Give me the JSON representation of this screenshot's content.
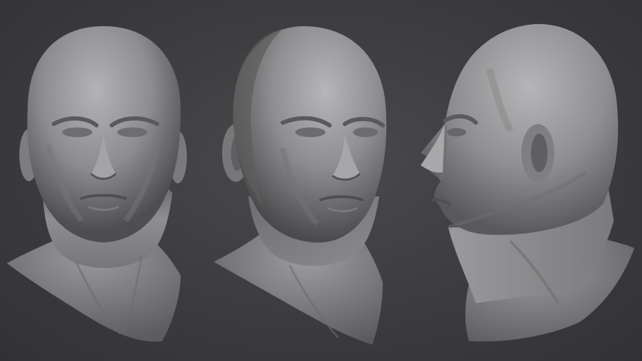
{
  "scene": {
    "background_color": "#3d3d3f",
    "material_color": "#9a9a9c",
    "views": [
      {
        "id": "front",
        "description_icon": "head-front-render"
      },
      {
        "id": "three-quarter",
        "description_icon": "head-three-quarter-render"
      },
      {
        "id": "profile",
        "description_icon": "head-profile-render"
      }
    ]
  }
}
